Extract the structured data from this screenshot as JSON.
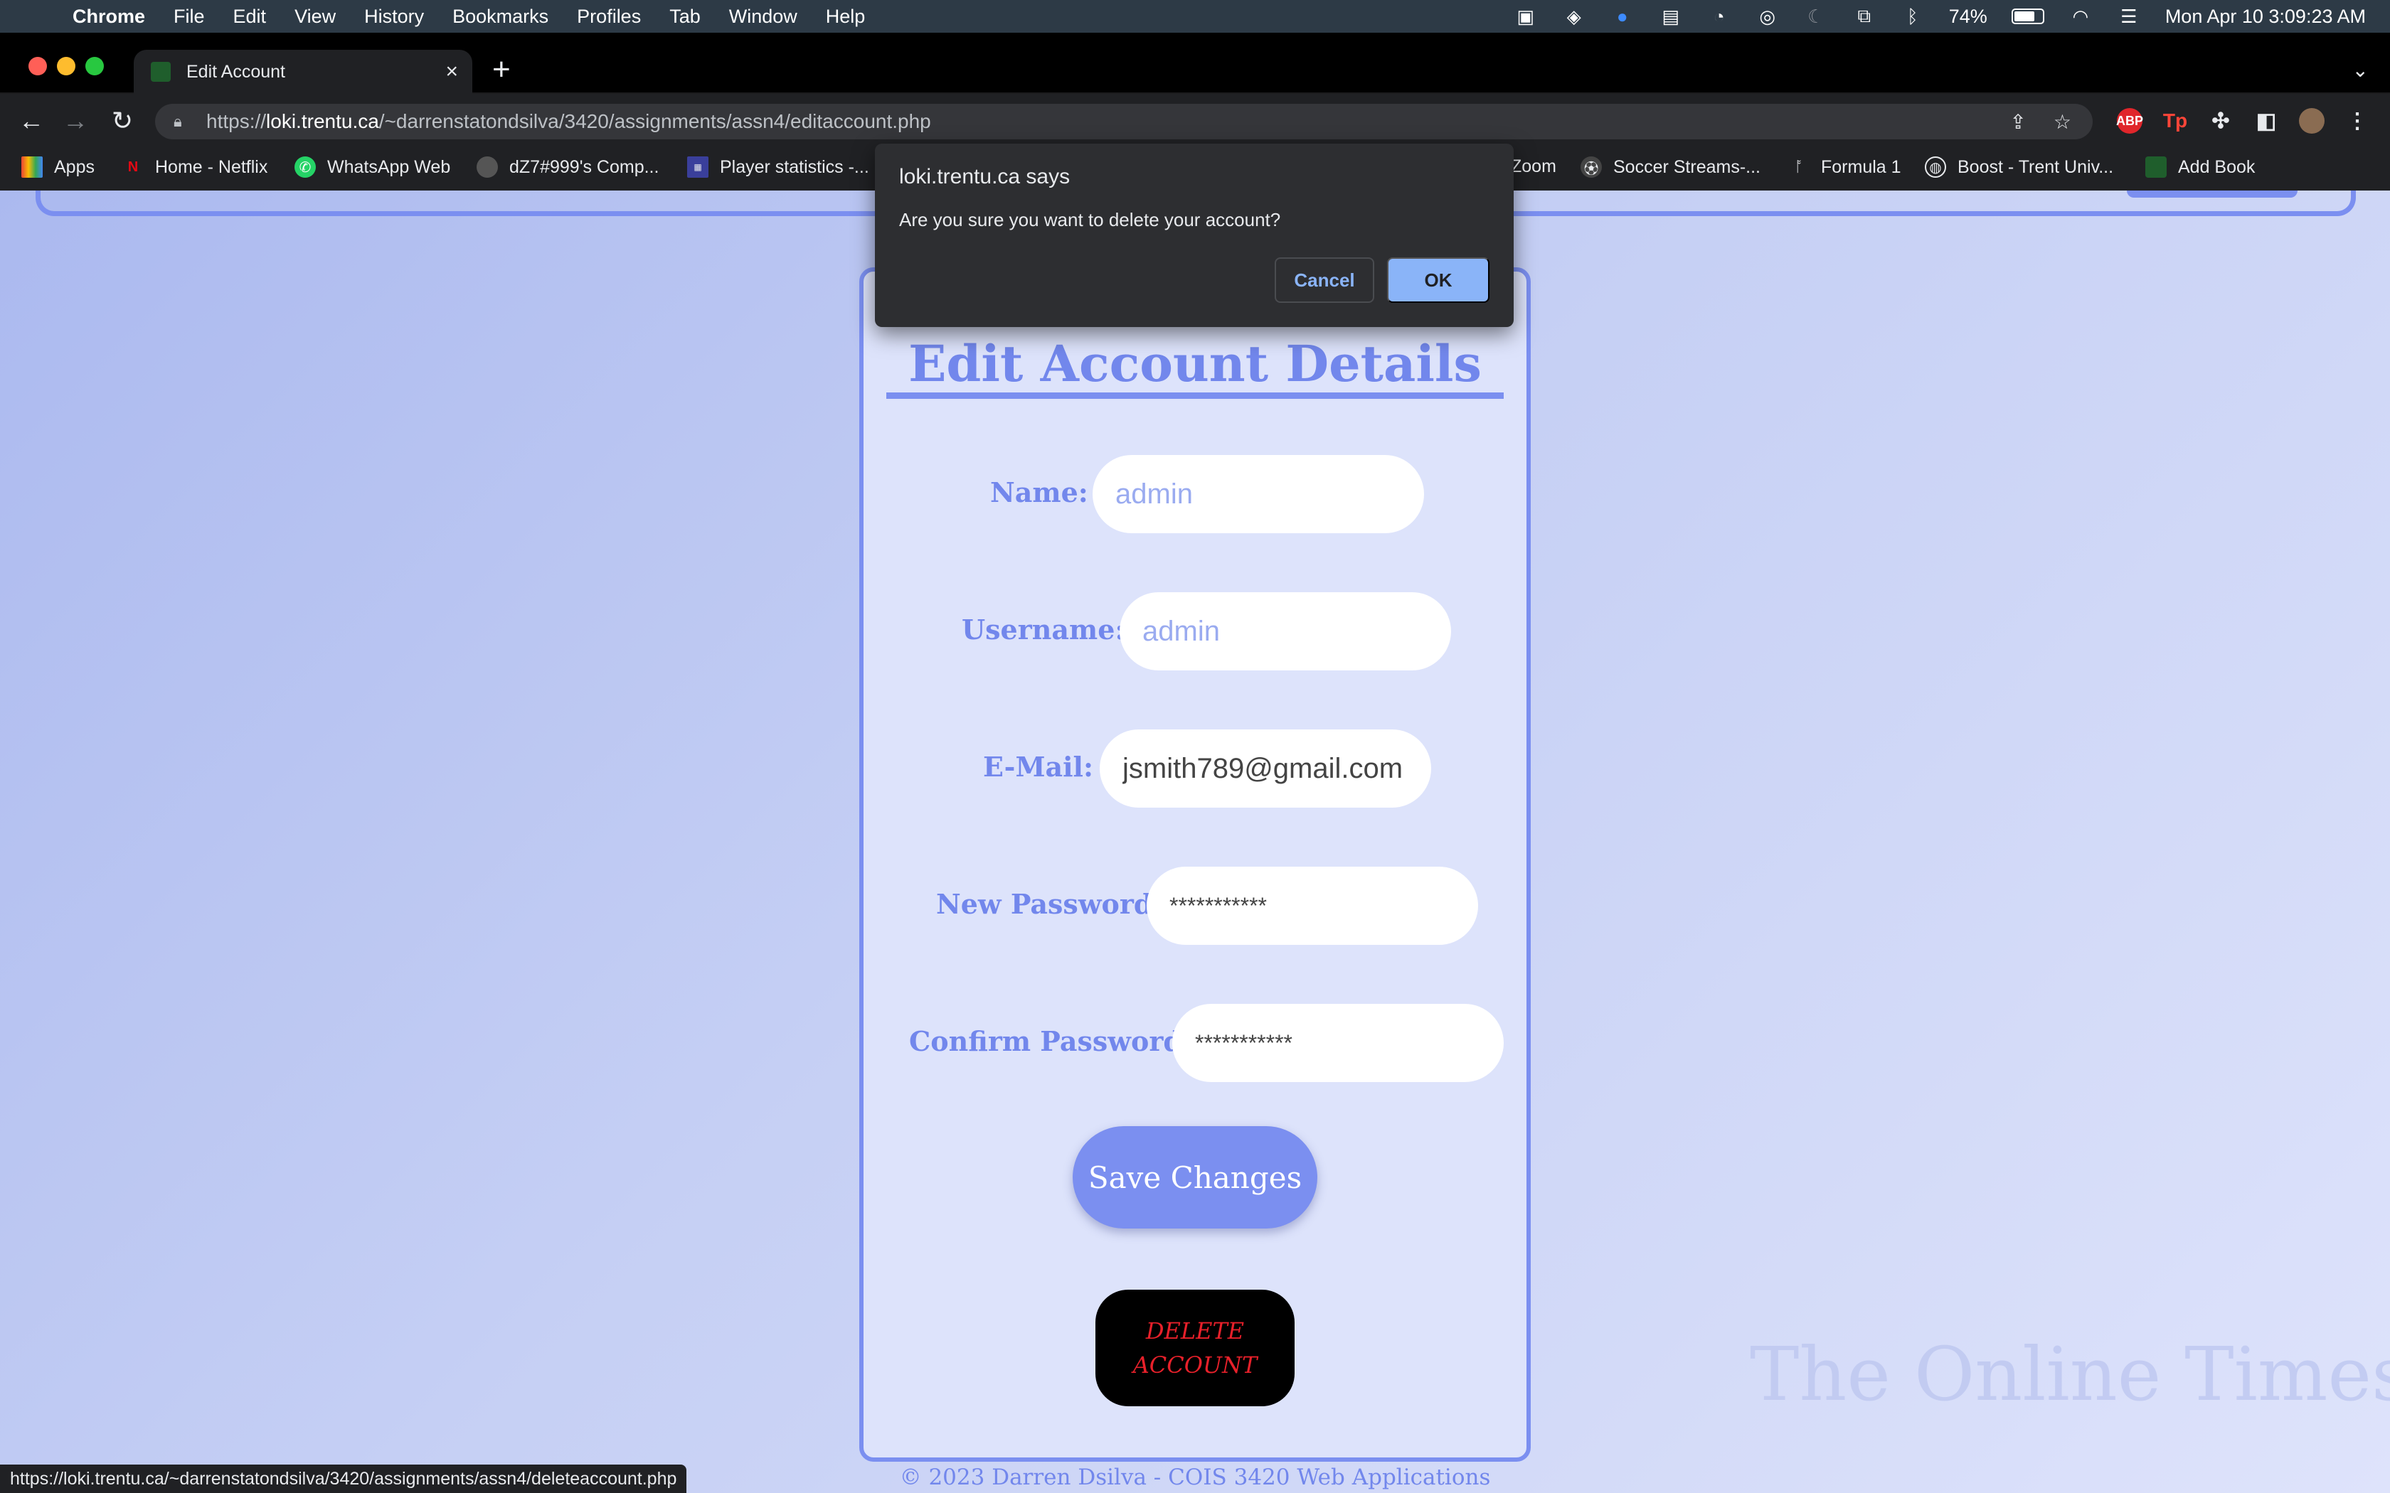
{
  "menubar": {
    "apple_icon": "apple-icon",
    "app_name": "Chrome",
    "items": [
      "File",
      "Edit",
      "View",
      "History",
      "Bookmarks",
      "Profiles",
      "Tab",
      "Window",
      "Help"
    ],
    "battery_percent": "74%",
    "battery_level": 0.74,
    "datetime": "Mon Apr 10  3:09:23 AM"
  },
  "browser": {
    "tab_title": "Edit Account",
    "url_scheme": "https://",
    "url_host": "loki.trentu.ca",
    "url_path": "/~darrenstatondsilva/3420/assignments/assn4/editaccount.php",
    "bookmarks": [
      "Apps",
      "Home - Netflix",
      "WhatsApp Web",
      "dZ7#999's Comp...",
      "Player statistics -...",
      "Zoom",
      "Soccer Streams-...",
      "Formula 1",
      "Boost - Trent Univ...",
      "Add Book"
    ],
    "extensions": [
      "ABP",
      "Tp"
    ],
    "status_url": "https://loki.trentu.ca/~darrenstatondsilva/3420/assignments/assn4/deleteaccount.php"
  },
  "dialog": {
    "title": "loki.trentu.ca says",
    "message": "Are you sure you want to delete your account?",
    "cancel_label": "Cancel",
    "ok_label": "OK"
  },
  "form": {
    "heading": "Edit Account Details",
    "name_label": "Name:",
    "name_placeholder": "admin",
    "username_label": "Username:",
    "username_placeholder": "admin",
    "email_label": "E-Mail:",
    "email_value": "jsmith789@gmail.com",
    "new_password_label": "New Password:",
    "new_password_value": "***********",
    "confirm_password_label": "Confirm Password:",
    "confirm_password_value": "***********",
    "save_label": "Save Changes",
    "delete_line1": "DELETE",
    "delete_line2": "ACCOUNT"
  },
  "page": {
    "watermark": "The Online Times",
    "footer": "© 2023 Darren Dsilva - COIS 3420 Web Applications"
  },
  "colors": {
    "accent": "#7b8ff0",
    "delete_bg": "#000000",
    "delete_text": "#e8202a",
    "dialog_ok": "#8ab4f8"
  }
}
